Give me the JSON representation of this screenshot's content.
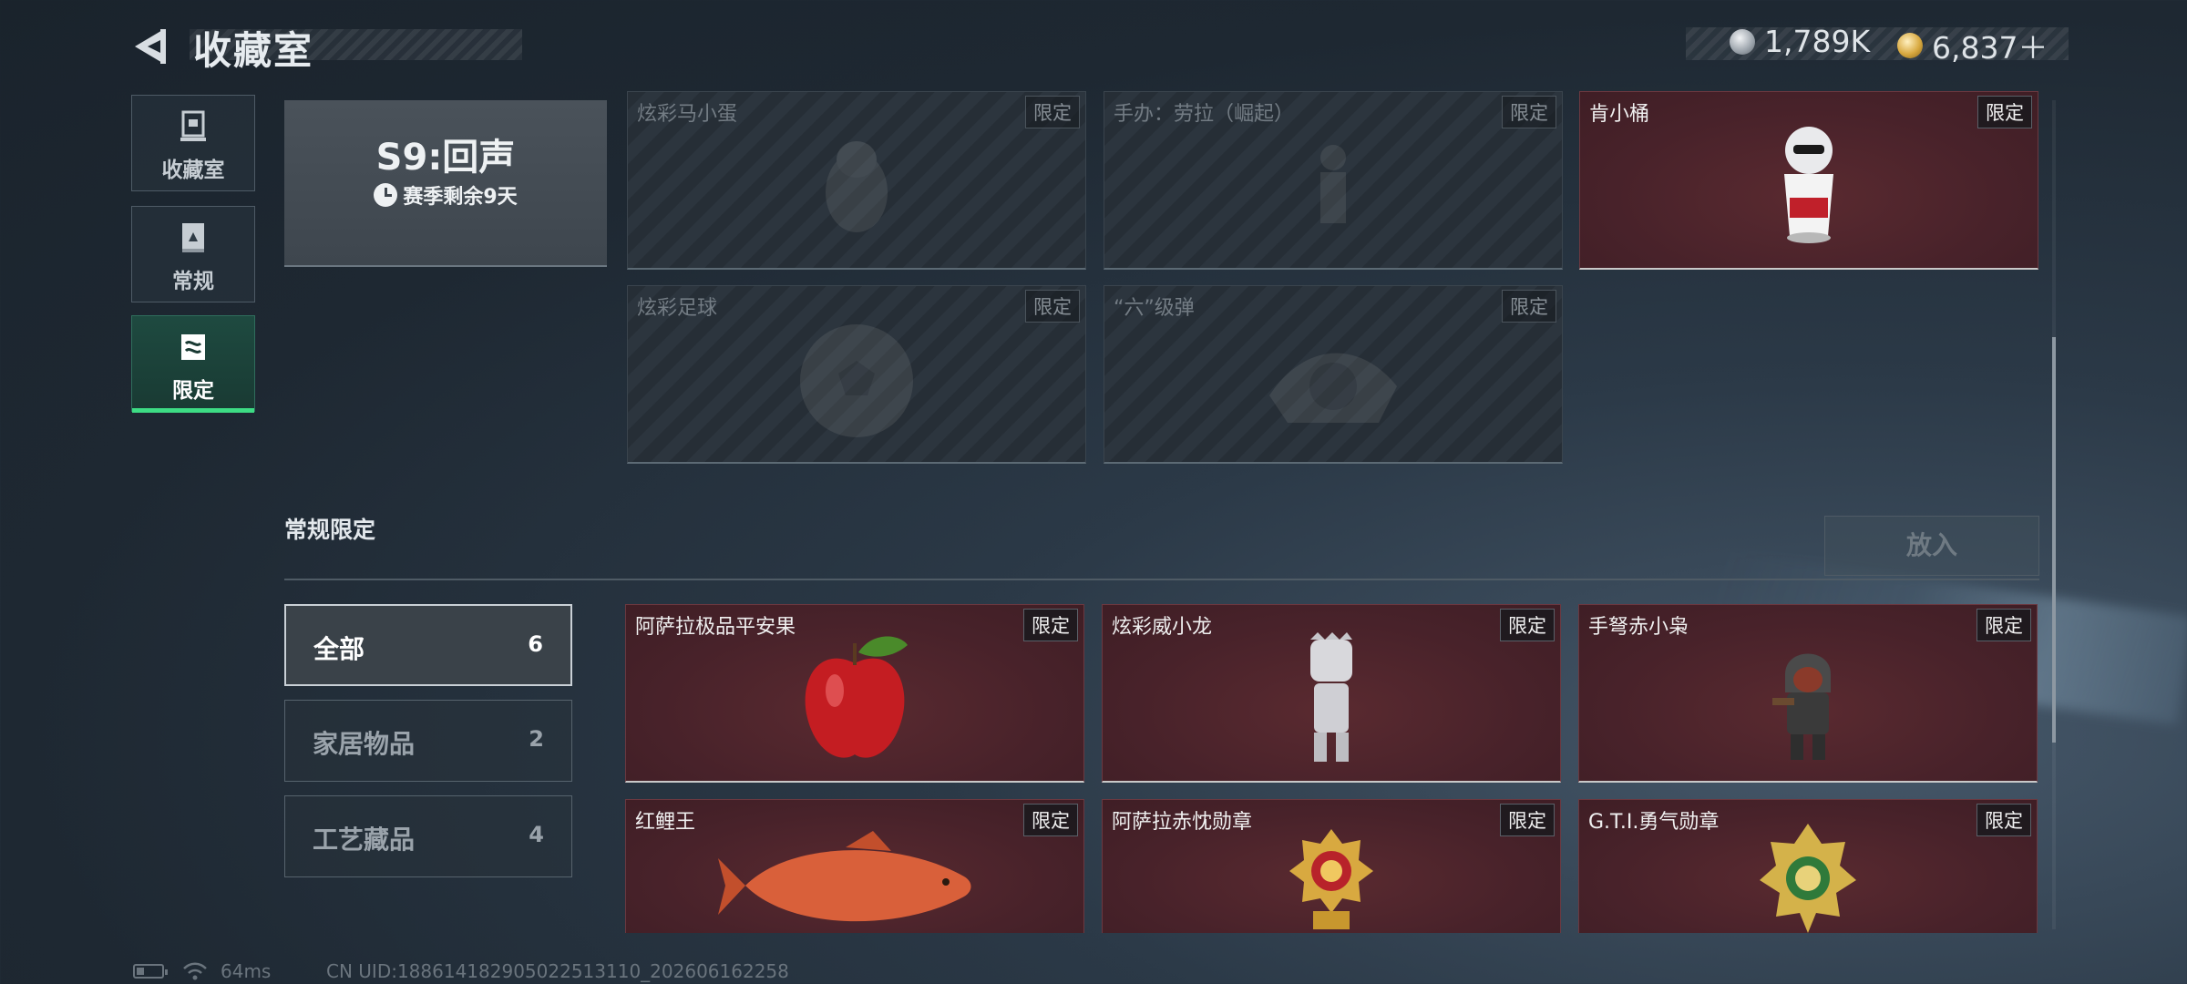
{
  "header": {
    "title": "收藏室",
    "currency_silver": "1,789K",
    "currency_gold": "6,837＋"
  },
  "nav": [
    {
      "label": "收藏室",
      "icon": "trophy-icon"
    },
    {
      "label": "常规",
      "icon": "book-icon"
    },
    {
      "label": "限定",
      "icon": "limited-icon",
      "active": true
    }
  ],
  "season": {
    "title": "S9:回声",
    "subtitle": "赛季剩余9天"
  },
  "season_cards": [
    {
      "name": "炫彩马小蛋",
      "badge": "限定"
    },
    {
      "name": "手办：劳拉（崛起）",
      "badge": "限定"
    },
    {
      "name": "肯小桶",
      "badge": "限定"
    },
    {
      "name": "炫彩足球",
      "badge": "限定"
    },
    {
      "name": "“六”级弹",
      "badge": "限定"
    }
  ],
  "section": {
    "title": "常规限定",
    "put_button": "放入"
  },
  "filters": [
    {
      "label": "全部",
      "count": "6",
      "active": true
    },
    {
      "label": "家居物品",
      "count": "2"
    },
    {
      "label": "工艺藏品",
      "count": "4"
    }
  ],
  "items": [
    {
      "name": "阿萨拉极品平安果",
      "badge": "限定"
    },
    {
      "name": "炫彩威小龙",
      "badge": "限定"
    },
    {
      "name": "手弩赤小枭",
      "badge": "限定"
    },
    {
      "name": "红鲤王",
      "badge": "限定"
    },
    {
      "name": "阿萨拉赤忱勋章",
      "badge": "限定"
    },
    {
      "name": "G.T.I.勇气勋章",
      "badge": "限定"
    }
  ],
  "footer": {
    "ping": "64ms",
    "uid": "CN UID:188614182905022513110_202606162258"
  },
  "colors": {
    "accent": "#3ddc84",
    "owned_card": "#48222a",
    "locked_card": "#262e36"
  }
}
